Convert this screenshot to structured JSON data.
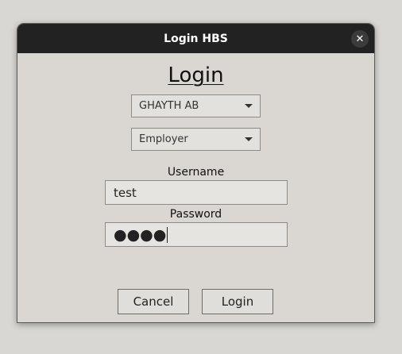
{
  "window": {
    "title": "Login HBS",
    "close_glyph": "✕"
  },
  "heading": "Login",
  "company_select": {
    "selected": "GHAYTH AB"
  },
  "role_select": {
    "selected": "Employer"
  },
  "username": {
    "label": "Username",
    "value": "test"
  },
  "password": {
    "label": "Password",
    "masked_value": "●●●●"
  },
  "buttons": {
    "cancel": "Cancel",
    "login": "Login"
  }
}
